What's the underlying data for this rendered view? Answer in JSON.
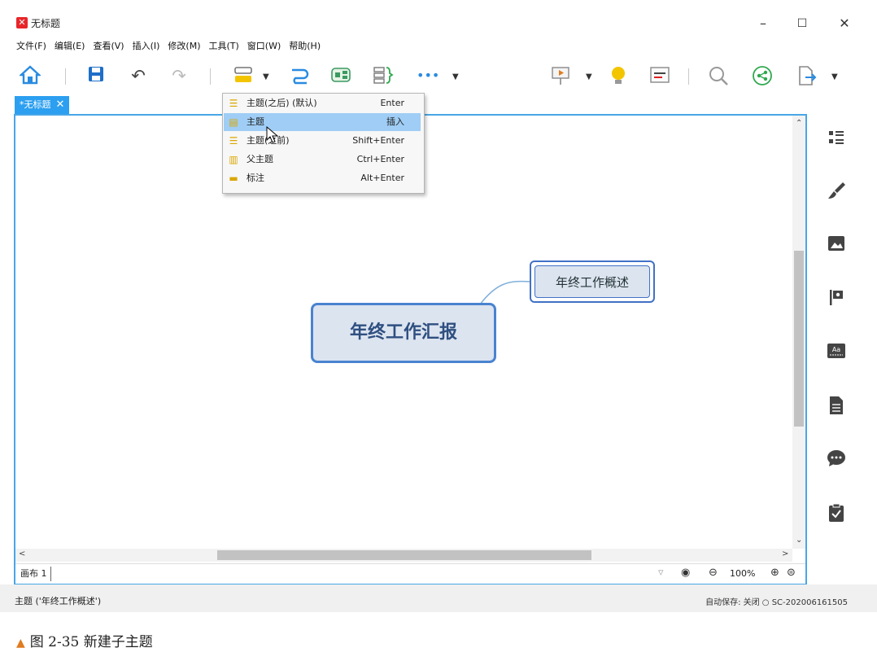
{
  "window": {
    "title": "无标题",
    "minimize": "–",
    "maximize": "☐",
    "close": "✕"
  },
  "menu": [
    "文件(F)",
    "编辑(E)",
    "查看(V)",
    "插入(I)",
    "修改(M)",
    "工具(T)",
    "窗口(W)",
    "帮助(H)"
  ],
  "tab": {
    "label": "*无标题",
    "close": "✕"
  },
  "dropdown": [
    {
      "label": "主题(之后) (默认)",
      "shortcut": "Enter"
    },
    {
      "label": "主题",
      "shortcut": "插入"
    },
    {
      "label": "主题(之前)",
      "shortcut": "Shift+Enter"
    },
    {
      "label": "父主题",
      "shortcut": "Ctrl+Enter"
    },
    {
      "label": "标注",
      "shortcut": "Alt+Enter"
    }
  ],
  "map": {
    "central": "年终工作汇报",
    "subtopic": "年终工作概述"
  },
  "sheetbar": {
    "sheet": "画布 1",
    "zoom": "100%"
  },
  "status": {
    "left": "主题 ('年终工作概述')",
    "right": "自动保存: 关闭   ○ SC-202006161505"
  },
  "caption": {
    "marker": "▲",
    "text": "图 2-35   新建子主题"
  },
  "colors": {
    "accent": "#2c9ff0",
    "topic_border": "#4a83d0",
    "topic_fill": "#dce4f0",
    "highlight": "#9fcdf5"
  }
}
